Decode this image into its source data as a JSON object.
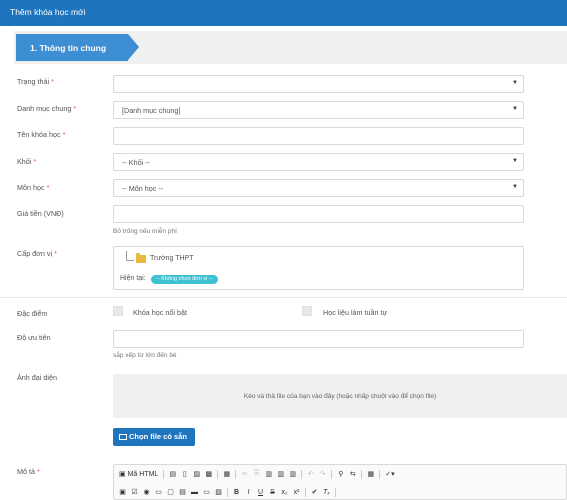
{
  "header": {
    "title": "Thêm khóa học mới"
  },
  "step": {
    "label": "1. Thông tin chung"
  },
  "form": {
    "status": {
      "label": "Trạng thái",
      "value": ""
    },
    "category": {
      "label": "Danh mục chung",
      "value": "[Danh mục chung]"
    },
    "course_name": {
      "label": "Tên khóa học",
      "value": ""
    },
    "grade": {
      "label": "Khối",
      "value": "-- Khối --"
    },
    "subject": {
      "label": "Môn học",
      "value": "-- Môn học --"
    },
    "price": {
      "label": "Giá tiền (VNĐ)",
      "value": "",
      "hint": "Bỏ trống nếu miễn phí"
    },
    "unit": {
      "label": "Cấp đơn vị",
      "tree_item": "Trường THPT",
      "current_label": "Hiện tại:",
      "current_value": "-- Không chọn đơn vị --"
    },
    "features": {
      "label": "Đặc điểm",
      "featured": "Khóa học nổi bật",
      "sequential": "Học liệu làm tuần tự"
    },
    "priority": {
      "label": "Độ ưu tiên",
      "value": "",
      "hint": "sắp xếp từ lớn đến bé"
    },
    "image": {
      "label": "Ảnh đại diện",
      "dropzone_text": "Kéo và thả file của bạn vào đây (hoặc nhấp chuột vào để chọn file)",
      "choose_button": "Chọn file có sẵn"
    },
    "description": {
      "label": "Mô tả"
    },
    "required_mark": "*"
  },
  "editor": {
    "source_label": "Mã HTML",
    "row1_icons": [
      "save-icon",
      "new-page-icon",
      "preview-icon",
      "print-icon",
      "templates-icon",
      "cut-icon",
      "copy-icon",
      "paste-icon",
      "paste-text-icon",
      "paste-word-icon",
      "undo-icon",
      "redo-icon",
      "find-icon",
      "replace-icon",
      "select-all-icon",
      "spellcheck-icon"
    ],
    "row2_icons": [
      "form-icon",
      "checkbox-icon",
      "radio-icon",
      "textfield-icon",
      "textarea-icon",
      "select-icon",
      "button-icon",
      "imagebutton-icon",
      "hiddenfield-icon",
      "bold-icon",
      "italic-icon",
      "underline-icon",
      "strike-icon",
      "subscript-icon",
      "superscript-icon",
      "copy-format-icon",
      "remove-format-icon"
    ],
    "bold": "B",
    "italic": "I",
    "underline": "U",
    "strike": "S",
    "subscript": "x₂",
    "superscript": "x²"
  }
}
